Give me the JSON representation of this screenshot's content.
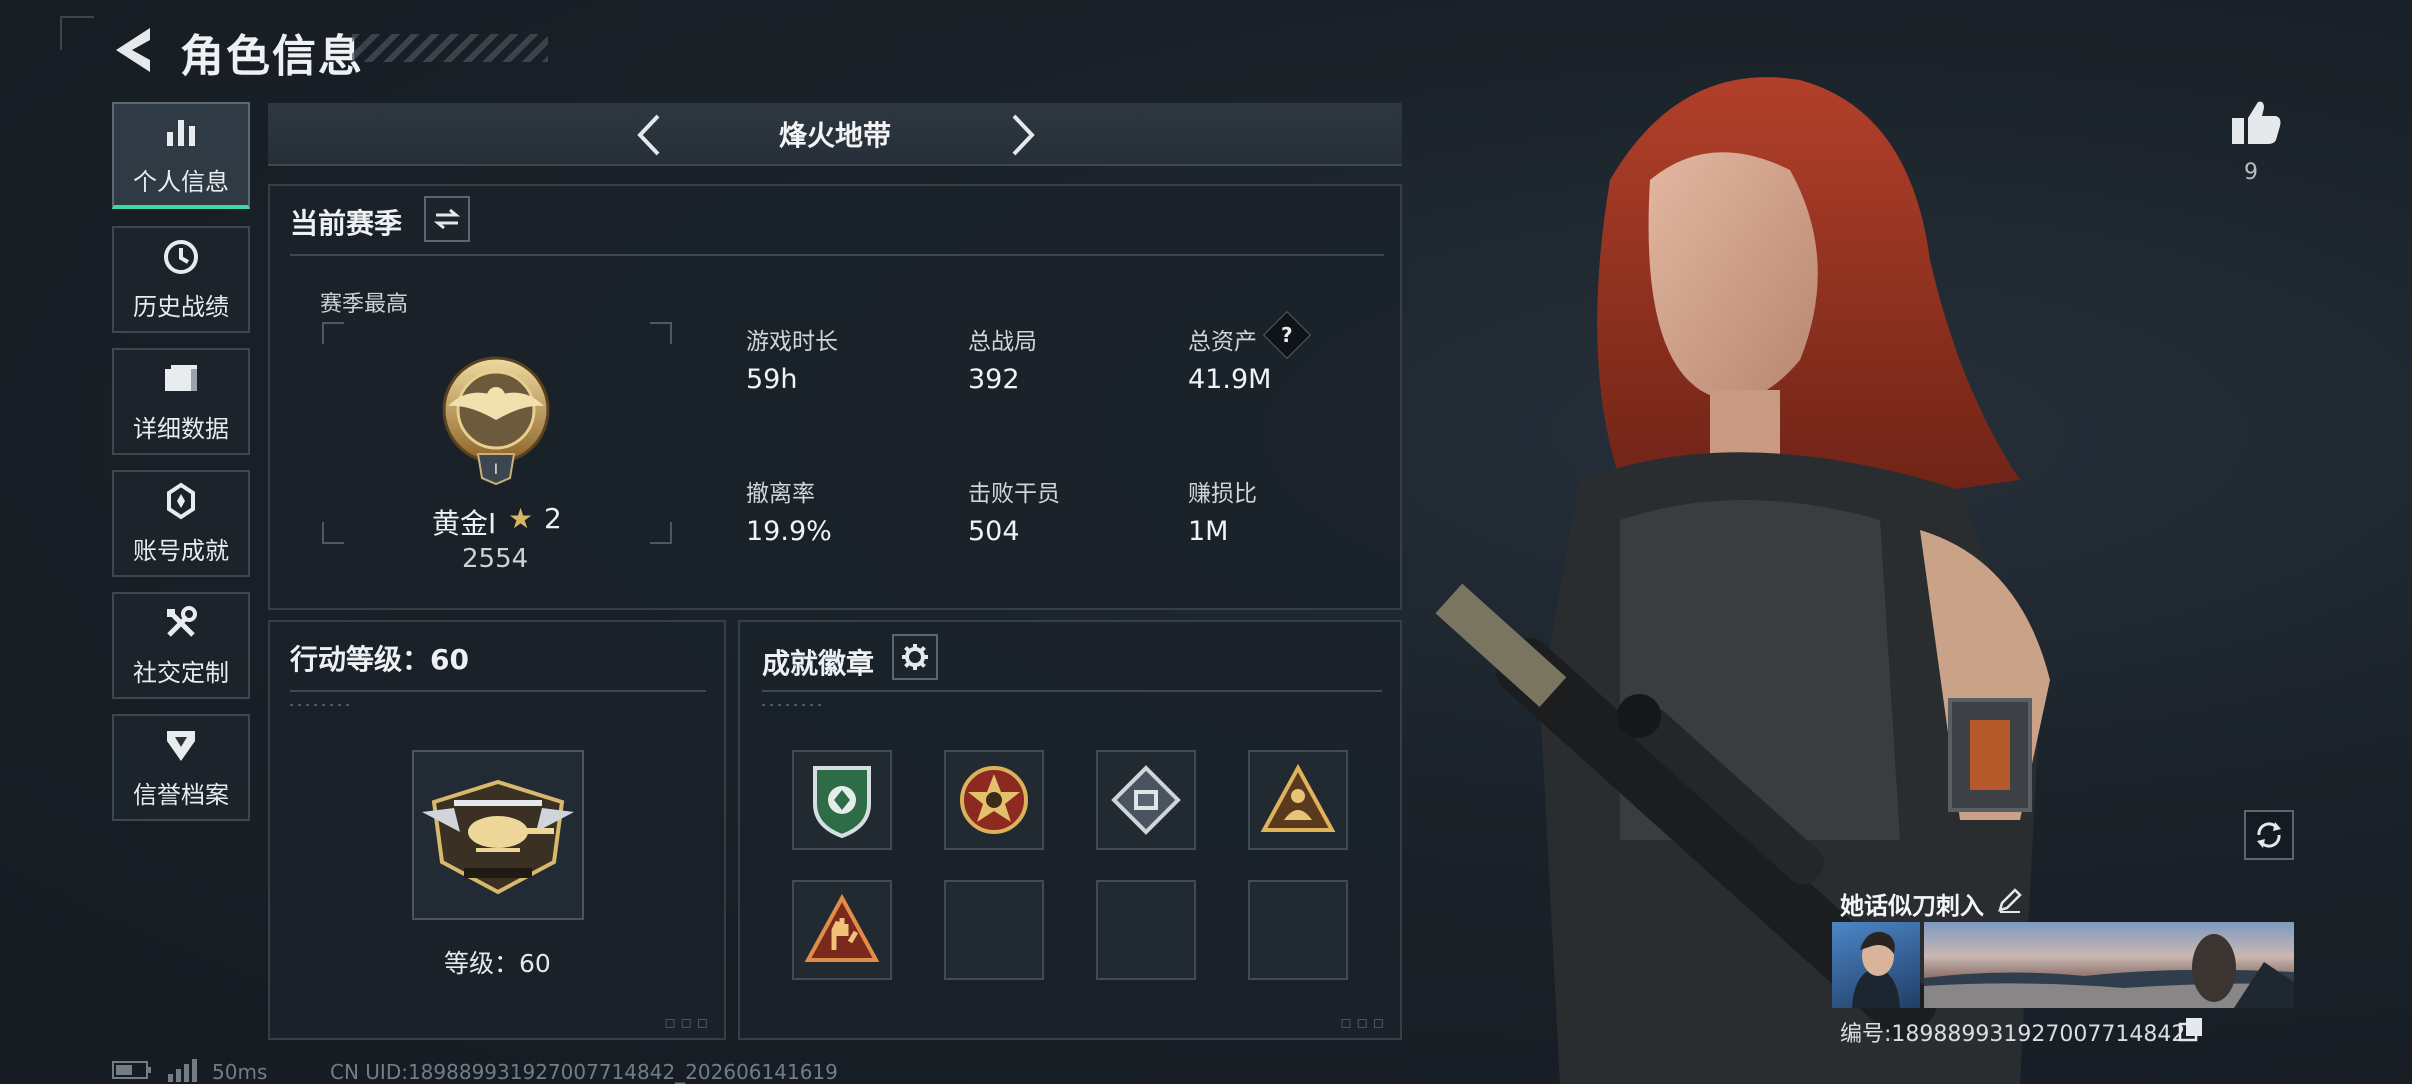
{
  "header": {
    "title": "角色信息"
  },
  "sidebar": {
    "items": [
      {
        "label": "个人信息",
        "icon": "bar-chart-icon",
        "active": true
      },
      {
        "label": "历史战绩",
        "icon": "history-clock-icon",
        "active": false
      },
      {
        "label": "详细数据",
        "icon": "folder-icon",
        "active": false
      },
      {
        "label": "账号成就",
        "icon": "achievement-icon",
        "active": false
      },
      {
        "label": "社交定制",
        "icon": "tools-icon",
        "active": false
      },
      {
        "label": "信誉档案",
        "icon": "shield-icon",
        "active": false
      }
    ]
  },
  "mode_tabs": {
    "current": "烽火地带"
  },
  "season": {
    "title": "当前赛季",
    "best_label": "赛季最高",
    "rank_name": "黄金Ⅰ",
    "rank_stars": "2",
    "rank_score": "2554",
    "stats": [
      {
        "label": "游戏时长",
        "value": "59h"
      },
      {
        "label": "总战局",
        "value": "392"
      },
      {
        "label": "总资产",
        "value": "41.9M"
      },
      {
        "label": "撤离率",
        "value": "19.9%"
      },
      {
        "label": "击败干员",
        "value": "504"
      },
      {
        "label": "赚损比",
        "value": "1M"
      }
    ],
    "help_symbol": "?"
  },
  "action_level": {
    "title": "行动等级：60",
    "level_text": "等级：60"
  },
  "badges": {
    "title": "成就徽章",
    "slots": [
      {
        "icon": "green-shield-badge-icon",
        "filled": true
      },
      {
        "icon": "star-medal-badge-icon",
        "filled": true
      },
      {
        "icon": "diamond-chip-badge-icon",
        "filled": true
      },
      {
        "icon": "triangle-figure-badge-icon",
        "filled": true
      },
      {
        "icon": "triangle-hand-badge-icon",
        "filled": true
      },
      {
        "icon": "",
        "filled": false
      },
      {
        "icon": "",
        "filled": false
      },
      {
        "icon": "",
        "filled": false
      }
    ]
  },
  "likes": {
    "count": "9"
  },
  "profile_card": {
    "name": "她话似刀刺入",
    "id_text": "编号:1898899319270077148​42"
  },
  "footer": {
    "ping": "50ms",
    "uid": "CN UID:1898899319270077148​42_202606141619"
  },
  "colors": {
    "accent": "#3fd8a5",
    "gold": "#d7b566",
    "panel": "#1b2229"
  }
}
